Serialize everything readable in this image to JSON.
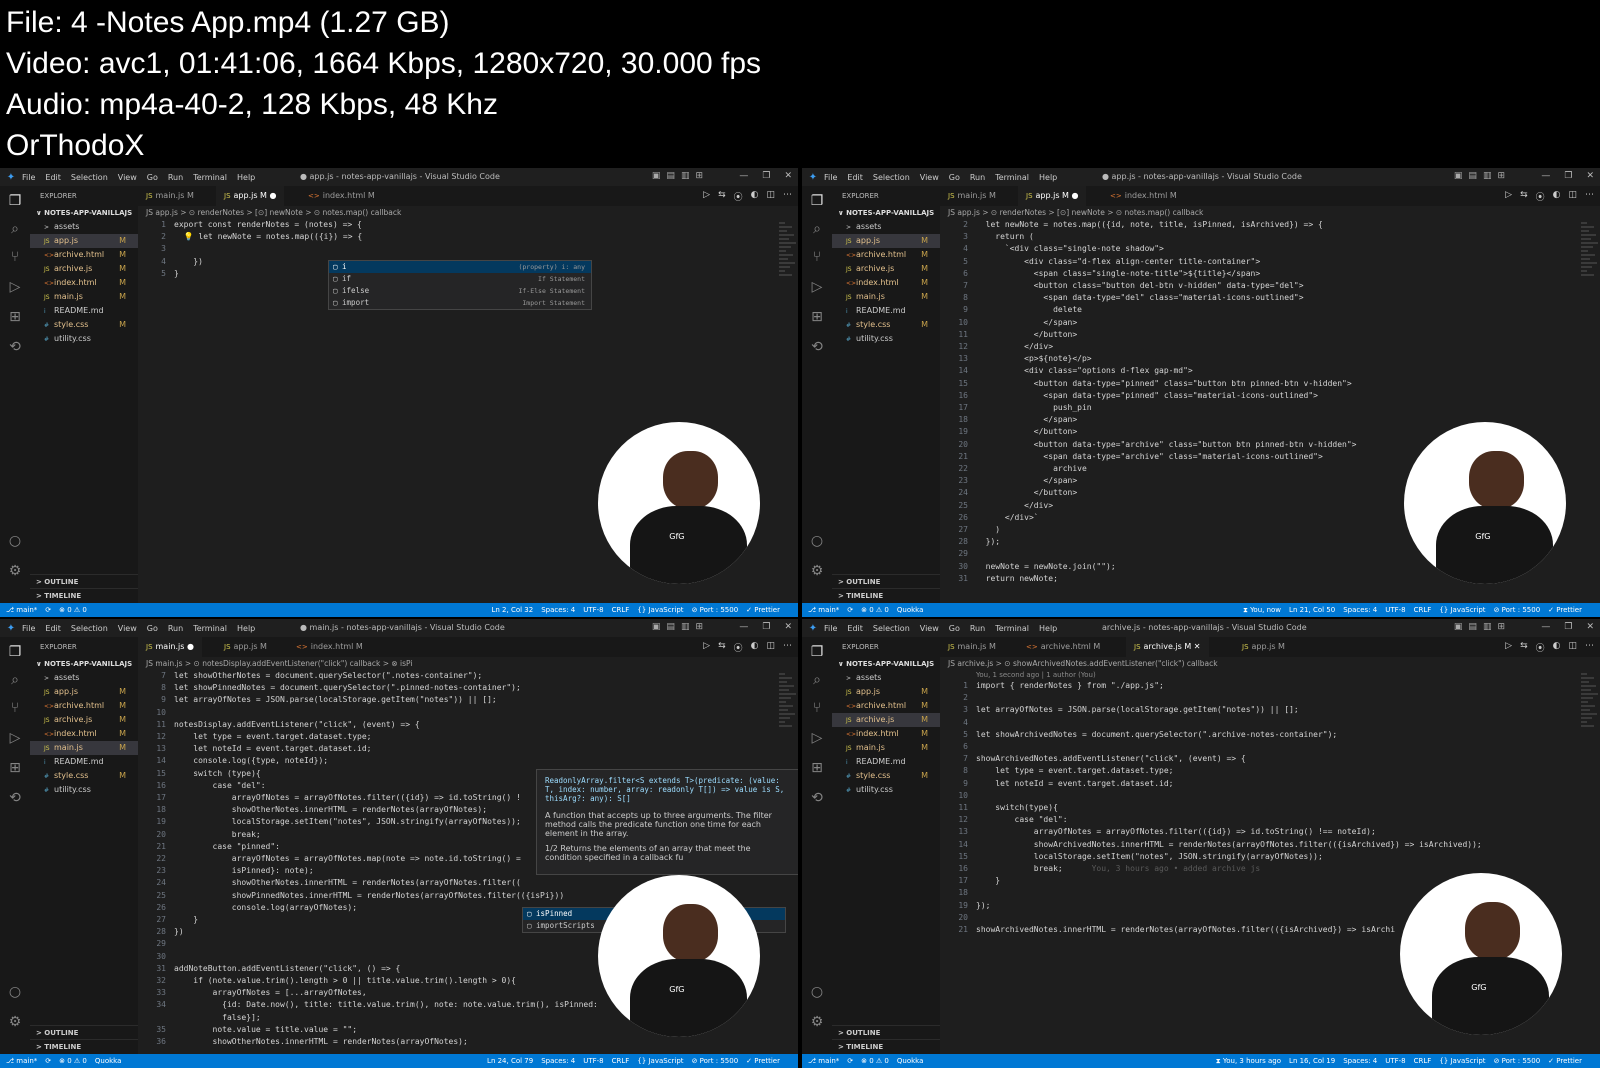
{
  "header": {
    "file_line": "File: 4 -Notes App.mp4 (1.27 GB)",
    "video_line": "Video: avc1, 01:41:06, 1664 Kbps, 1280x720, 30.000 fps",
    "audio_line": "Audio: mp4a-40-2, 128 Kbps, 48 Khz",
    "uploader": "OrThodoX"
  },
  "menu": [
    "File",
    "Edit",
    "Selection",
    "View",
    "Go",
    "Run",
    "Terminal",
    "Help"
  ],
  "explorer": {
    "label": "EXPLORER",
    "project": "NOTES-APP-VANILLAJS",
    "files": [
      {
        "name": "assets",
        "icon": ">"
      },
      {
        "name": "app.js",
        "icon": "JS",
        "status": "M"
      },
      {
        "name": "archive.html",
        "icon": "<>",
        "status": "M"
      },
      {
        "name": "archive.js",
        "icon": "JS",
        "status": "M"
      },
      {
        "name": "index.html",
        "icon": "<>",
        "status": "M"
      },
      {
        "name": "main.js",
        "icon": "JS",
        "status": "M"
      },
      {
        "name": "README.md",
        "icon": "i"
      },
      {
        "name": "style.css",
        "icon": "#",
        "status": "M"
      },
      {
        "name": "utility.css",
        "icon": "#"
      }
    ],
    "outline": "OUTLINE",
    "timeline": "TIMELINE"
  },
  "panels": [
    {
      "title": "● app.js - notes-app-vanillajs - Visual Studio Code",
      "active_file": "app.js",
      "tabs": [
        {
          "lang": "JS",
          "label": "main.js",
          "mark": "M"
        },
        {
          "lang": "JS",
          "label": "app.js",
          "mark": "M ●",
          "active": true
        },
        {
          "lang": "<>",
          "label": "index.html",
          "mark": "M"
        }
      ],
      "breadcrumb": "JS app.js > ⊙ renderNotes > [⊙] newNote > ⊙ notes.map() callback",
      "lines": [
        {
          "n": "1",
          "code": "export const renderNotes = (notes) => {"
        },
        {
          "n": "2",
          "code": "  💡 let newNote = notes.map(({i}) => {"
        },
        {
          "n": "3",
          "code": ""
        },
        {
          "n": "4",
          "code": "    })"
        },
        {
          "n": "5",
          "code": "}"
        }
      ],
      "suggest": [
        {
          "label": "i",
          "detail": "(property) i: any",
          "selected": true
        },
        {
          "label": "if",
          "detail": "If Statement"
        },
        {
          "label": "ifelse",
          "detail": "If-Else Statement"
        },
        {
          "label": "import",
          "detail": "Import Statement"
        }
      ],
      "status_left": [
        "⎇ main*",
        "⟳",
        "⊗ 0 ⚠ 0"
      ],
      "status_right": [
        "Ln 2, Col 32",
        "Spaces: 4",
        "UTF-8",
        "CRLF",
        "{} JavaScript",
        "⊘ Port : 5500",
        "✓ Prettier"
      ]
    },
    {
      "title": "● app.js - notes-app-vanillajs - Visual Studio Code",
      "active_file": "app.js",
      "tabs": [
        {
          "lang": "JS",
          "label": "main.js",
          "mark": "M"
        },
        {
          "lang": "JS",
          "label": "app.js",
          "mark": "M ●",
          "active": true
        },
        {
          "lang": "<>",
          "label": "index.html",
          "mark": "M"
        }
      ],
      "breadcrumb": "JS app.js > ⊙ renderNotes > [⊙] newNote > ⊙ notes.map() callback",
      "lines": [
        {
          "n": "2",
          "code": "  let newNote = notes.map(({id, note, title, isPinned, isArchived}) => {"
        },
        {
          "n": "3",
          "code": "    return ("
        },
        {
          "n": "4",
          "code": "      `<div class=\"single-note shadow\">"
        },
        {
          "n": "5",
          "code": "          <div class=\"d-flex align-center title-container\">"
        },
        {
          "n": "6",
          "code": "            <span class=\"single-note-title\">${title}</span>"
        },
        {
          "n": "7",
          "code": "            <button class=\"button del-btn v-hidden\" data-type=\"del\">"
        },
        {
          "n": "8",
          "code": "              <span data-type=\"del\" class=\"material-icons-outlined\">"
        },
        {
          "n": "9",
          "code": "                delete"
        },
        {
          "n": "10",
          "code": "              </span>"
        },
        {
          "n": "11",
          "code": "            </button>"
        },
        {
          "n": "12",
          "code": "          </div>"
        },
        {
          "n": "13",
          "code": "          <p>${note}</p>"
        },
        {
          "n": "14",
          "code": "          <div class=\"options d-flex gap-md\">"
        },
        {
          "n": "15",
          "code": "            <button data-type=\"pinned\" class=\"button btn pinned-btn v-hidden\">"
        },
        {
          "n": "16",
          "code": "              <span data-type=\"pinned\" class=\"material-icons-outlined\">"
        },
        {
          "n": "17",
          "code": "                push_pin"
        },
        {
          "n": "18",
          "code": "              </span>"
        },
        {
          "n": "19",
          "code": "            </button>"
        },
        {
          "n": "20",
          "code": "            <button data-type=\"archive\" class=\"button btn pinned-btn v-hidden\">"
        },
        {
          "n": "21",
          "code": "              <span data-type=\"archive\" class=\"material-icons-outlined\">"
        },
        {
          "n": "22",
          "code": "                archive"
        },
        {
          "n": "23",
          "code": "              </span>"
        },
        {
          "n": "24",
          "code": "            </button>"
        },
        {
          "n": "25",
          "code": "          </div>"
        },
        {
          "n": "26",
          "code": "      </div>`"
        },
        {
          "n": "27",
          "code": "    )"
        },
        {
          "n": "28",
          "code": "  });"
        },
        {
          "n": "29",
          "code": ""
        },
        {
          "n": "30",
          "code": "  newNote = newNote.join(\"\");"
        },
        {
          "n": "31",
          "code": "  return newNote;"
        }
      ],
      "status_left": [
        "⎇ main*",
        "⟳",
        "⊗ 0 ⚠ 0",
        "Quokka"
      ],
      "status_right": [
        "⧗ You, now",
        "Ln 21, Col 50",
        "Spaces: 4",
        "UTF-8",
        "CRLF",
        "{} JavaScript",
        "⊘ Port : 5500",
        "✓ Prettier"
      ]
    },
    {
      "title": "● main.js - notes-app-vanillajs - Visual Studio Code",
      "active_file": "main.js",
      "tabs": [
        {
          "lang": "JS",
          "label": "main.js",
          "mark": "●",
          "active": true
        },
        {
          "lang": "JS",
          "label": "app.js",
          "mark": "M"
        },
        {
          "lang": "<>",
          "label": "index.html",
          "mark": "M"
        }
      ],
      "breadcrumb": "JS main.js > ⊙ notesDisplay.addEventListener(\"click\") callback > ⊗ isPi",
      "lines": [
        {
          "n": "7",
          "code": "let showOtherNotes = document.querySelector(\".notes-container\");"
        },
        {
          "n": "8",
          "code": "let showPinnedNotes = document.querySelector(\".pinned-notes-container\");"
        },
        {
          "n": "9",
          "code": "let arrayOfNotes = JSON.parse(localStorage.getItem(\"notes\")) || [];"
        },
        {
          "n": "10",
          "code": ""
        },
        {
          "n": "11",
          "code": "notesDisplay.addEventListener(\"click\", (event) => {"
        },
        {
          "n": "12",
          "code": "    let type = event.target.dataset.type;"
        },
        {
          "n": "13",
          "code": "    let noteId = event.target.dataset.id;"
        },
        {
          "n": "14",
          "code": "    console.log({type, noteId});"
        },
        {
          "n": "15",
          "code": "    switch (type){"
        },
        {
          "n": "16",
          "code": "        case \"del\":"
        },
        {
          "n": "17",
          "code": "            arrayOfNotes = arrayOfNotes.filter(({id}) => id.toString() !"
        },
        {
          "n": "18",
          "code": "            showOtherNotes.innerHTML = renderNotes(arrayOfNotes);"
        },
        {
          "n": "19",
          "code": "            localStorage.setItem(\"notes\", JSON.stringify(arrayOfNotes));"
        },
        {
          "n": "20",
          "code": "            break;"
        },
        {
          "n": "21",
          "code": "        case \"pinned\":"
        },
        {
          "n": "22",
          "code": "            arrayOfNotes = arrayOfNotes.map(note => note.id.toString() ="
        },
        {
          "n": "23",
          "code": "            isPinned}: note);"
        },
        {
          "n": "24",
          "code": "            showOtherNotes.innerHTML = renderNotes(arrayOfNotes.filter(("
        },
        {
          "n": "25",
          "code": "            showPinnedNotes.innerHTML = renderNotes(arrayOfNotes.filter(({isPi}))"
        },
        {
          "n": "26",
          "code": "            console.log(arrayOfNotes);"
        },
        {
          "n": "27",
          "code": "    }"
        },
        {
          "n": "28",
          "code": "})"
        },
        {
          "n": "29",
          "code": ""
        },
        {
          "n": "30",
          "code": ""
        },
        {
          "n": "31",
          "code": "addNoteButton.addEventListener(\"click\", () => {"
        },
        {
          "n": "32",
          "code": "    if (note.value.trim().length > 0 || title.value.trim().length > 0){"
        },
        {
          "n": "33",
          "code": "        arrayOfNotes = [...arrayOfNotes,"
        },
        {
          "n": "34",
          "code": "          {id: Date.now(), title: title.value.trim(), note: note.value.trim(), isPinned:"
        },
        {
          "n": "",
          "code": "          false}];"
        },
        {
          "n": "35",
          "code": "        note.value = title.value = \"\";"
        },
        {
          "n": "36",
          "code": "        showOtherNotes.innerHTML = renderNotes(arrayOfNotes);"
        }
      ],
      "hover": {
        "signature": "ReadonlyArray.filter<S extends T>(predicate: (value: T, index: number, array: readonly T[]) => value is S, thisArg?: any): S[]",
        "desc1": "A function that accepts up to three arguments. The filter method calls the predicate function one time for each element in the array.",
        "counter": "1/2",
        "desc2": "Returns the elements of an array that meet the condition specified in a callback fu"
      },
      "suggest": [
        {
          "label": "isPinned",
          "detail": "",
          "selected": true
        },
        {
          "label": "importScripts",
          "detail": ""
        }
      ],
      "status_left": [
        "⎇ main*",
        "⟳",
        "⊗ 0 ⚠ 0",
        "Quokka"
      ],
      "status_right": [
        "Ln 24, Col 79",
        "Spaces: 4",
        "UTF-8",
        "CRLF",
        "{} JavaScript",
        "⊘ Port : 5500",
        "✓ Prettier"
      ]
    },
    {
      "title": "archive.js - notes-app-vanillajs - Visual Studio Code",
      "active_file": "archive.js",
      "tabs": [
        {
          "lang": "JS",
          "label": "main.js",
          "mark": "M"
        },
        {
          "lang": "<>",
          "label": "archive.html",
          "mark": "M"
        },
        {
          "lang": "JS",
          "label": "archive.js",
          "mark": "M ✕",
          "active": true
        },
        {
          "lang": "JS",
          "label": "app.js",
          "mark": "M"
        }
      ],
      "breadcrumb": "JS archive.js > ⊙ showArchivedNotes.addEventListener(\"click\") callback",
      "codelens": "You, 1 second ago | 1 author (You)",
      "lines": [
        {
          "n": "1",
          "code": "import { renderNotes } from \"./app.js\";"
        },
        {
          "n": "2",
          "code": ""
        },
        {
          "n": "3",
          "code": "let arrayOfNotes = JSON.parse(localStorage.getItem(\"notes\")) || [];"
        },
        {
          "n": "4",
          "code": ""
        },
        {
          "n": "5",
          "code": "let showArchivedNotes = document.querySelector(\".archive-notes-container\");"
        },
        {
          "n": "6",
          "code": ""
        },
        {
          "n": "7",
          "code": "showArchivedNotes.addEventListener(\"click\", (event) => {"
        },
        {
          "n": "8",
          "code": "    let type = event.target.dataset.type;"
        },
        {
          "n": "9",
          "code": "    let noteId = event.target.dataset.id;"
        },
        {
          "n": "10",
          "code": ""
        },
        {
          "n": "11",
          "code": "    switch(type){"
        },
        {
          "n": "12",
          "code": "        case \"del\":"
        },
        {
          "n": "13",
          "code": "            arrayOfNotes = arrayOfNotes.filter(({id}) => id.toString() !== noteId);"
        },
        {
          "n": "14",
          "code": "            showArchivedNotes.innerHTML = renderNotes(arrayOfNotes.filter(({isArchived}) => isArchived));"
        },
        {
          "n": "15",
          "code": "            localStorage.setItem(\"notes\", JSON.stringify(arrayOfNotes));"
        },
        {
          "n": "16",
          "code": "            break;      You, 3 hours ago • added archive js"
        },
        {
          "n": "17",
          "code": "    }"
        },
        {
          "n": "18",
          "code": ""
        },
        {
          "n": "19",
          "code": "});"
        },
        {
          "n": "20",
          "code": ""
        },
        {
          "n": "21",
          "code": "showArchivedNotes.innerHTML = renderNotes(arrayOfNotes.filter(({isArchived}) => isArchi"
        }
      ],
      "status_left": [
        "⎇ main*",
        "⟳",
        "⊗ 0 ⚠ 0",
        "Quokka"
      ],
      "status_right": [
        "⧗ You, 3 hours ago",
        "Ln 16, Col 19",
        "Spaces: 4",
        "UTF-8",
        "CRLF",
        "{} JavaScript",
        "⊘ Port : 5500",
        "✓ Prettier"
      ]
    }
  ],
  "avatar": {
    "logo_text": "GeeksforGeeks"
  },
  "colors": {
    "statusbar": "#0078d4",
    "editor_bg": "#1e1e1e",
    "sidebar_bg": "#181818"
  }
}
